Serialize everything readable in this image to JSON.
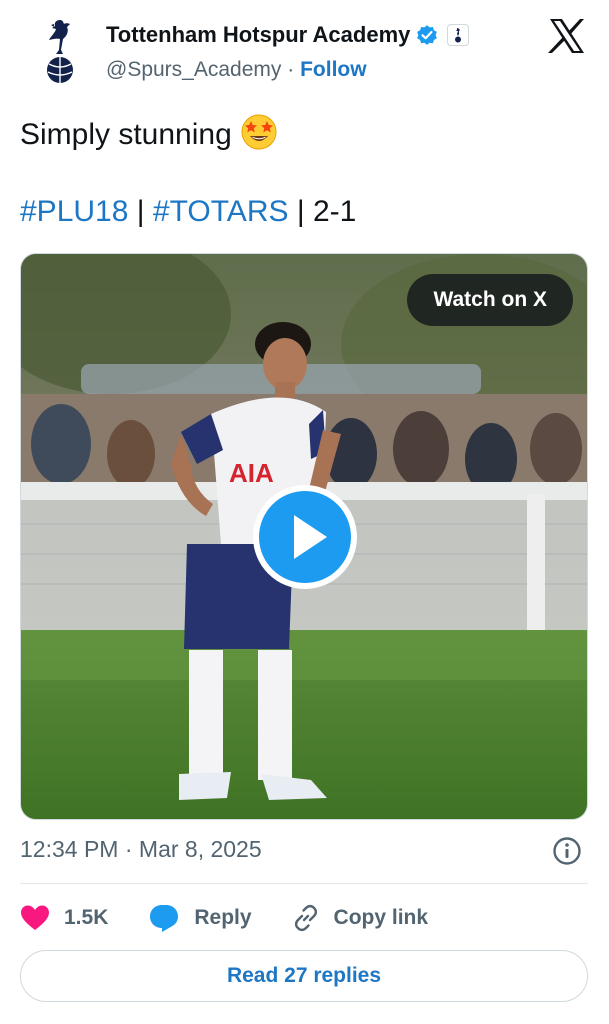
{
  "author": {
    "display_name": "Tottenham Hotspur Academy",
    "handle": "@Spurs_Academy",
    "separator": "·",
    "follow_label": "Follow"
  },
  "tweet": {
    "text": "Simply stunning",
    "tag_1": "#PLU18",
    "sep_1": "|",
    "tag_2": "#TOTARS",
    "sep_2": "|",
    "score": "2-1"
  },
  "media": {
    "watch_label": "Watch on X",
    "player_shirt_sponsor": "AIA"
  },
  "meta": {
    "time": "12:34 PM",
    "separator": "·",
    "date": "Mar 8, 2025"
  },
  "actions": {
    "likes": "1.5K",
    "reply_label": "Reply",
    "copy_link_label": "Copy link"
  },
  "read_replies_label": "Read 27 replies",
  "colors": {
    "link_blue": "#1d77c4",
    "heart": "#f91880",
    "reply_bubble": "#1d9bf0",
    "play_button": "#1d9bf0",
    "muted_text": "#536471"
  },
  "icons": [
    "spurs-crest-icon",
    "verified-badge-icon",
    "affiliate-crest-icon",
    "x-logo-icon",
    "star-struck-emoji-icon",
    "play-icon",
    "info-icon",
    "heart-icon",
    "reply-icon",
    "link-icon"
  ]
}
